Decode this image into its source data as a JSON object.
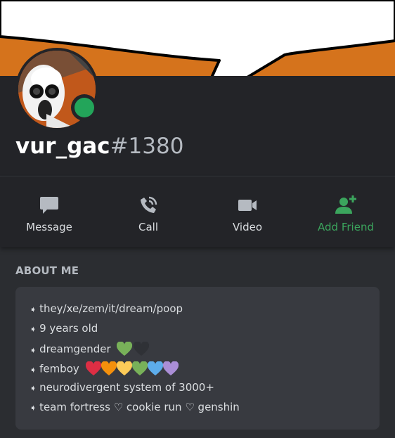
{
  "profile": {
    "username": "vur_gac",
    "discriminator": "#1380",
    "status": "online",
    "status_color": "#23a55a",
    "banner_color": "#d5731c"
  },
  "actions": [
    {
      "label": "Message",
      "icon": "message-icon"
    },
    {
      "label": "Call",
      "icon": "phone-icon"
    },
    {
      "label": "Video",
      "icon": "video-icon"
    },
    {
      "label": "Add Friend",
      "icon": "add-friend-icon",
      "color": "#3ba55d"
    }
  ],
  "about": {
    "title": "ABOUT ME",
    "lines": [
      "they/xe/zem/it/dream/poop",
      "9 years old",
      "dreamgender",
      "femboy",
      "neurodivergent system of 3000+",
      "team fortress ♡ cookie run ♡ genshin"
    ],
    "bullet": "➧"
  }
}
